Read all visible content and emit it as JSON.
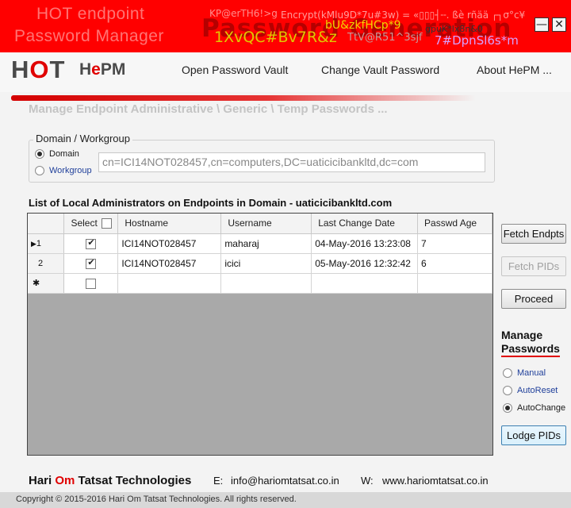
{
  "titlebar": {
    "title_line1": "HOT endpoint",
    "title_line2": "Password Manager",
    "watermark": "Password Generation",
    "noise": {
      "n1": "KP@erTH6!>g",
      "n2": "Encrypt(kMlu9D*7u#3w) = «▯▯▯┤╌. ßè rñää ┌┐σ°c¥",
      "n3": "bU&zkfHCp*9",
      "n4": "1XvQC#Bv7R&z",
      "n5": "TtV@R51^3sjf",
      "n6": "gpuK*Ix8n&0",
      "n7": "7#DpnSl6s*m"
    },
    "minimize_glyph": "—",
    "close_glyph": "✕"
  },
  "header": {
    "logo_hot_h": "H",
    "logo_hot_o": "O",
    "logo_hot_t": "T",
    "logo_hepm_h": "H",
    "logo_hepm_e": "e",
    "logo_hepm_pm": "PM",
    "menu": {
      "open_vault": "Open Password Vault",
      "change_vault": "Change Vault Password",
      "about": "About HePM ..."
    }
  },
  "section_title": "Manage Endpoint Administrative \\ Generic \\ Temp Passwords ...",
  "domain_group": {
    "legend": "Domain / Workgroup",
    "domain_label": "Domain",
    "workgroup_label": "Workgroup",
    "selected": "Domain",
    "value": "cn=ICI14NOT028457,cn=computers,DC=uaticicibankltd,dc=com"
  },
  "list_title": "List of Local Administrators on Endpoints in Domain -  uaticicibankltd.com",
  "grid": {
    "headers": {
      "select": "Select",
      "hostname": "Hostname",
      "username": "Username",
      "last_change": "Last Change Date",
      "age": "Passwd Age"
    },
    "rows": [
      {
        "marker": "▶",
        "num": "1",
        "selected": true,
        "hostname": "ICI14NOT028457",
        "username": "maharaj",
        "last_change": "04-May-2016 13:23:08",
        "age": "7"
      },
      {
        "marker": "",
        "num": "2",
        "selected": true,
        "hostname": "ICI14NOT028457",
        "username": "icici",
        "last_change": "05-May-2016 12:32:42",
        "age": "6"
      }
    ],
    "new_row_marker": "✱"
  },
  "buttons": {
    "fetch_endpts": "Fetch Endpts",
    "fetch_pids": "Fetch PIDs",
    "proceed": "Proceed",
    "lodge_pids": "Lodge PIDs"
  },
  "manage": {
    "title_line1": "Manage",
    "title_line2": "Passwords",
    "manual": "Manual",
    "autoreset": "AutoReset",
    "autochange": "AutoChange",
    "selected": "AutoChange"
  },
  "footer": {
    "company_pre": "Hari ",
    "company_om": "Om",
    "company_post": " Tatsat Technologies",
    "email_label": "E:",
    "email": "info@hariomtatsat.co.in",
    "web_label": "W:",
    "web": "www.hariomtatsat.co.in",
    "copyright": "Copyright © 2015-2016 Hari Om Tatsat Technologies.  All rights reserved."
  },
  "colors": {
    "brand_red": "#ff0000",
    "link_blue": "#1f3f9a",
    "disabled_text": "#a0a0a0"
  }
}
